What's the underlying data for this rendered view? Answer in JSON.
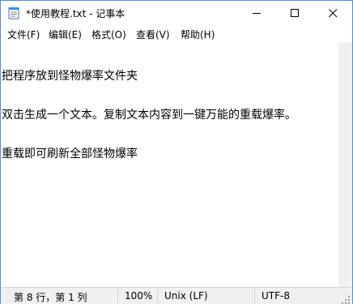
{
  "window": {
    "title": "*使用教程.txt - 记事本"
  },
  "menu": [
    "文件(F)",
    "编辑(E)",
    "格式(O)",
    "查看(V)",
    "帮助(H)"
  ],
  "document": {
    "lines": [
      "把程序放到怪物爆率文件夹",
      "双击生成一个文本。复制文本内容到一键万能的重载爆率。",
      "重载即可刷新全部怪物爆率"
    ]
  },
  "status": {
    "position": "第 8 行，第 1 列",
    "zoom": "100%",
    "line_ending": "Unix (LF)",
    "encoding": "UTF-8"
  },
  "icons": {
    "app": "notepad-icon",
    "minimize": "minimize-icon",
    "maximize": "maximize-icon",
    "close": "close-icon",
    "resize": "resize-grip-icon"
  }
}
